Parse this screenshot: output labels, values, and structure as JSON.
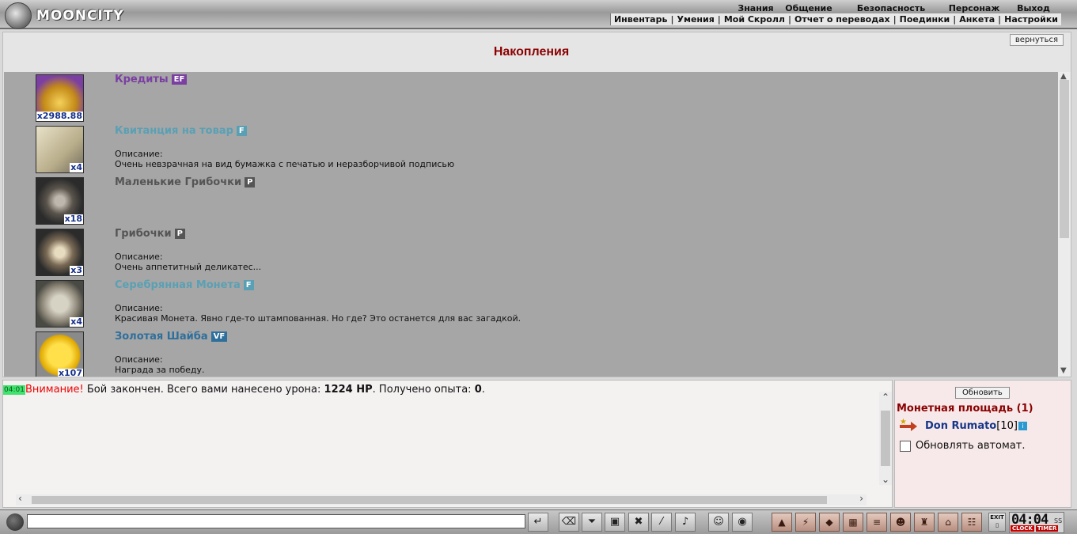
{
  "logo": {
    "text": "MOONCITY"
  },
  "nav_top": [
    {
      "label": "Знания"
    },
    {
      "label": "Общение"
    },
    {
      "label": "Безопасность"
    },
    {
      "label": "Персонаж"
    },
    {
      "label": "Выход"
    }
  ],
  "nav_sub": [
    {
      "label": "Инвентарь"
    },
    {
      "label": "Умения"
    },
    {
      "label": "Мой Скролл"
    },
    {
      "label": "Отчет о переводах"
    },
    {
      "label": "Поединки"
    },
    {
      "label": "Анкета"
    },
    {
      "label": "Настройки"
    }
  ],
  "main": {
    "back_label": "вернуться",
    "title": "Накопления",
    "desc_label": "Описание:",
    "items": [
      {
        "name": "Кредиты",
        "badge": "EF",
        "badge_color": "#7b3fa2",
        "name_color": "#7b3fa2",
        "qty": "x2988.88",
        "desc": ""
      },
      {
        "name": "Квитанция на товар",
        "badge": "F",
        "badge_color": "#5aa0b4",
        "name_color": "#5aa0b4",
        "qty": "x4",
        "desc": "Очень невзрачная на вид бумажка с печатью и неразборчивой подписью"
      },
      {
        "name": "Маленькие Грибочки",
        "badge": "P",
        "badge_color": "#555555",
        "name_color": "#555555",
        "qty": "x18",
        "desc": ""
      },
      {
        "name": "Грибочки",
        "badge": "P",
        "badge_color": "#555555",
        "name_color": "#555555",
        "qty": "x3",
        "desc": "Очень аппетитный деликатес..."
      },
      {
        "name": "Серебрянная Монета",
        "badge": "F",
        "badge_color": "#5aa0b4",
        "name_color": "#5aa0b4",
        "qty": "x4",
        "desc": "Красивая Монета. Явно где-то штампованная. Но где? Это останется для вас загадкой."
      },
      {
        "name": "Золотая Шайба",
        "badge": "VF",
        "badge_color": "#2f6f9c",
        "name_color": "#2f6f9c",
        "qty": "x107",
        "desc": "Награда за победу."
      }
    ]
  },
  "chat": {
    "time": "04:01",
    "warning": "Внимание!",
    "text_1": " Бой закончен. Всего вами нанесено урона: ",
    "damage": "1224 HP",
    "text_2": ". Получено опыта: ",
    "exp": "0",
    "text_3": "."
  },
  "right_panel": {
    "refresh_label": "Обновить",
    "location": "Монетная площадь (1)",
    "user_name": "Don Rumato",
    "user_level": "[10]",
    "auto_label": "Обновлять автомат."
  },
  "bottom": {
    "exit_label": "EXIT",
    "clock_time": "04:04",
    "clock_ss": "SS",
    "clock_label": "CLOCK",
    "timer_label": "TIMER"
  }
}
